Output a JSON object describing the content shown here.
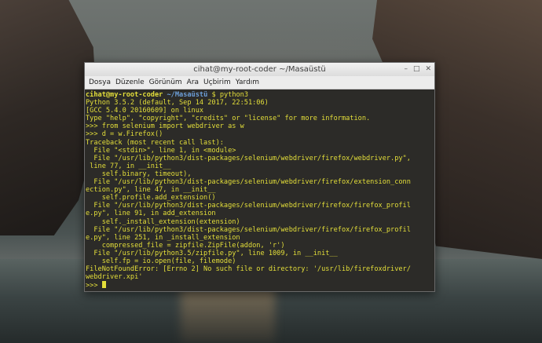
{
  "window": {
    "title": "cihat@my-root-coder ~/Masaüstü",
    "controls": {
      "minimize": "–",
      "maximize": "□",
      "close": "✕"
    }
  },
  "menu": [
    "Dosya",
    "Düzenle",
    "Görünüm",
    "Ara",
    "Uçbirim",
    "Yardım"
  ],
  "terminal": {
    "prompt_user": "cihat@my-root-coder",
    "prompt_path": "~/Masaüstü",
    "prompt_symbol": "$",
    "command": "python3",
    "lines": [
      "Python 3.5.2 (default, Sep 14 2017, 22:51:06)",
      "[GCC 5.4.0 20160609] on linux",
      "Type \"help\", \"copyright\", \"credits\" or \"license\" for more information.",
      ">>> from selenium import webdriver as w",
      ">>> d = w.Firefox()",
      "Traceback (most recent call last):",
      "  File \"<stdin>\", line 1, in <module>",
      "  File \"/usr/lib/python3/dist-packages/selenium/webdriver/firefox/webdriver.py\",",
      " line 77, in __init__",
      "    self.binary, timeout),",
      "  File \"/usr/lib/python3/dist-packages/selenium/webdriver/firefox/extension_conn",
      "ection.py\", line 47, in __init__",
      "    self.profile.add_extension()",
      "  File \"/usr/lib/python3/dist-packages/selenium/webdriver/firefox/firefox_profil",
      "e.py\", line 91, in add_extension",
      "    self._install_extension(extension)",
      "  File \"/usr/lib/python3/dist-packages/selenium/webdriver/firefox/firefox_profil",
      "e.py\", line 251, in _install_extension",
      "    compressed_file = zipfile.ZipFile(addon, 'r')",
      "  File \"/usr/lib/python3.5/zipfile.py\", line 1009, in __init__",
      "    self.fp = io.open(file, filemode)",
      "FileNotFoundError: [Errno 2] No such file or directory: '/usr/lib/firefoxdriver/",
      "webdriver.xpi'"
    ],
    "final_prompt": ">>> "
  }
}
